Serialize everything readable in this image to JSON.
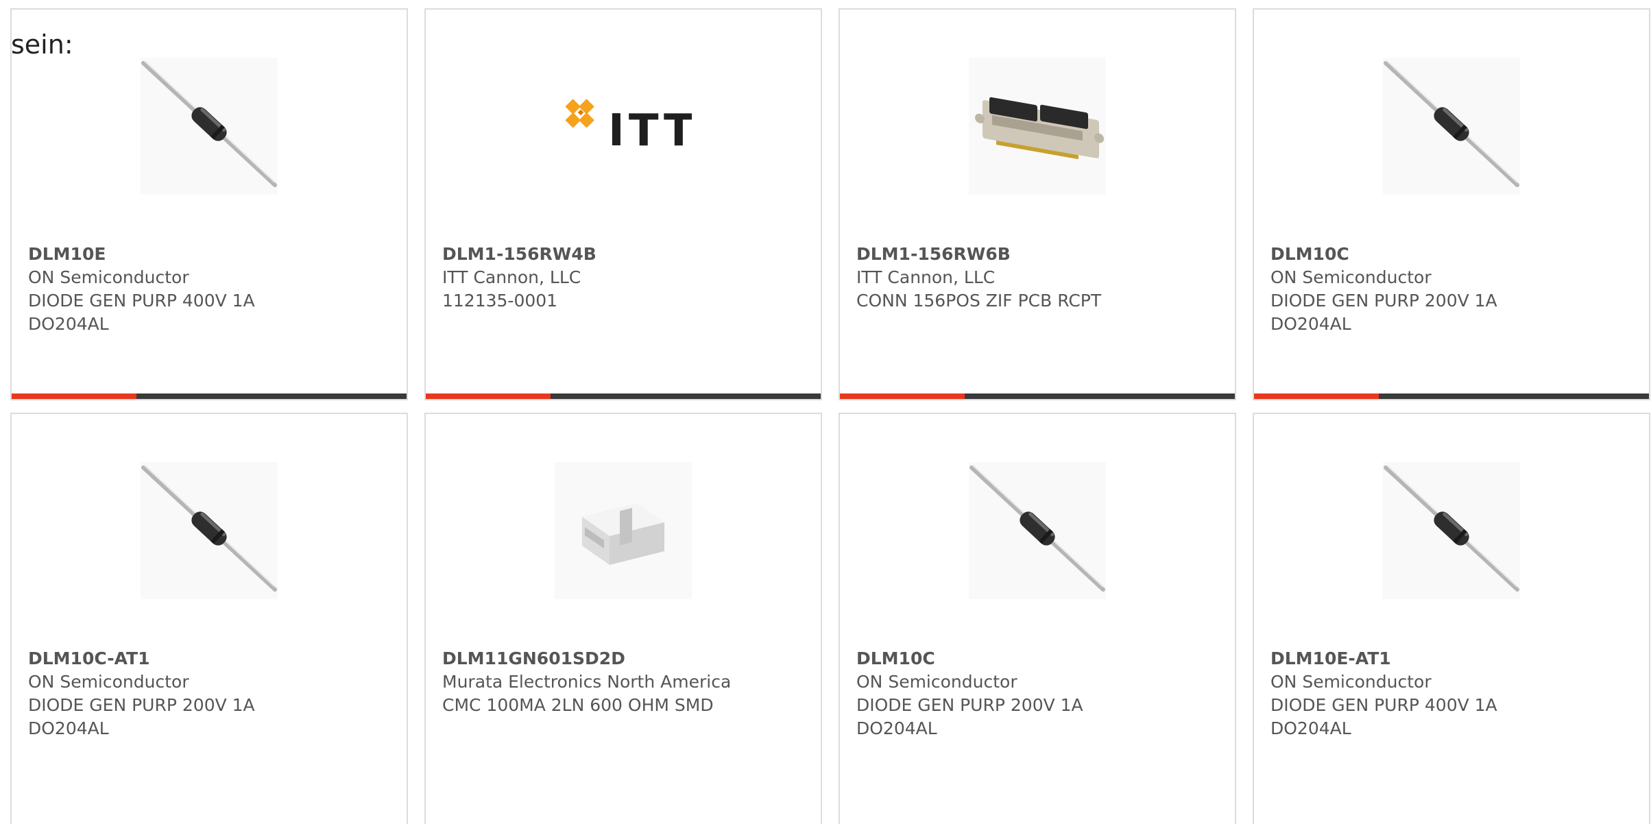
{
  "intro_text": "sein:",
  "colors": {
    "accent": "#e8391d",
    "bar": "#3a3a3a",
    "border": "#dcdcdc"
  },
  "cards": [
    {
      "part": "DLM10E",
      "maker": "ON Semiconductor",
      "desc1": "DIODE GEN PURP 400V 1A",
      "desc2": "DO204AL",
      "image": "axial-diode"
    },
    {
      "part": "DLM1-156RW4B",
      "maker": "ITT Cannon, LLC",
      "desc1": "112135-0001",
      "desc2": "",
      "image": "itt-logo",
      "logo_text": "ITT"
    },
    {
      "part": "DLM1-156RW6B",
      "maker": "ITT Cannon, LLC",
      "desc1": "CONN 156POS ZIF PCB RCPT",
      "desc2": "",
      "image": "connector"
    },
    {
      "part": "DLM10C",
      "maker": "ON Semiconductor",
      "desc1": "DIODE GEN PURP 200V 1A",
      "desc2": "DO204AL",
      "image": "axial-diode"
    },
    {
      "part": "DLM10C-AT1",
      "maker": "ON Semiconductor",
      "desc1": "DIODE GEN PURP 200V 1A",
      "desc2": "DO204AL",
      "image": "axial-diode"
    },
    {
      "part": "DLM11GN601SD2D",
      "maker": "Murata Electronics North America",
      "desc1": "CMC 100MA 2LN 600 OHM SMD",
      "desc2": "",
      "image": "smd-choke"
    },
    {
      "part": "DLM10C",
      "maker": "ON Semiconductor",
      "desc1": "DIODE GEN PURP 200V 1A",
      "desc2": "DO204AL",
      "image": "axial-diode"
    },
    {
      "part": "DLM10E-AT1",
      "maker": "ON Semiconductor",
      "desc1": "DIODE GEN PURP 400V 1A",
      "desc2": "DO204AL",
      "image": "axial-diode"
    }
  ]
}
